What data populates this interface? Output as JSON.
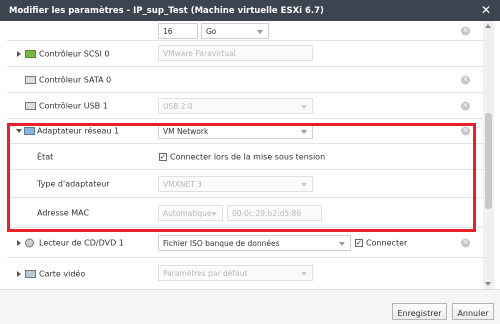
{
  "window": {
    "title": "Modifier les paramètres - IP_sup_Test (Machine virtuelle ESXi 6.7)"
  },
  "rows": {
    "top": {
      "value": "16",
      "unit": "Go"
    },
    "scsi": {
      "label": "Contrôleur SCSI 0",
      "value": "VMware Paravirtual"
    },
    "sata": {
      "label": "Contrôleur SATA 0"
    },
    "usb": {
      "label": "Contrôleur USB 1",
      "value": "USB 2.0"
    },
    "network": {
      "label": "Adaptateur réseau 1",
      "value": "VM Network"
    },
    "state": {
      "label": "État",
      "checkbox_label": "Connecter lors de la mise sous tension"
    },
    "adapter_type": {
      "label": "Type d'adaptateur",
      "value": "VMXNET 3"
    },
    "mac": {
      "label": "Adresse MAC",
      "mode": "Automatique",
      "value": "00:0c:29:b2:d5:86"
    },
    "cdrom": {
      "label": "Lecteur de CD/DVD 1",
      "value": "Fichier ISO banque de données",
      "connect_label": "Connecter"
    },
    "video": {
      "label": "Carte vidéo",
      "value": "Paramètres par défaut"
    }
  },
  "footer": {
    "save": "Enregistrer",
    "cancel": "Annuler"
  }
}
